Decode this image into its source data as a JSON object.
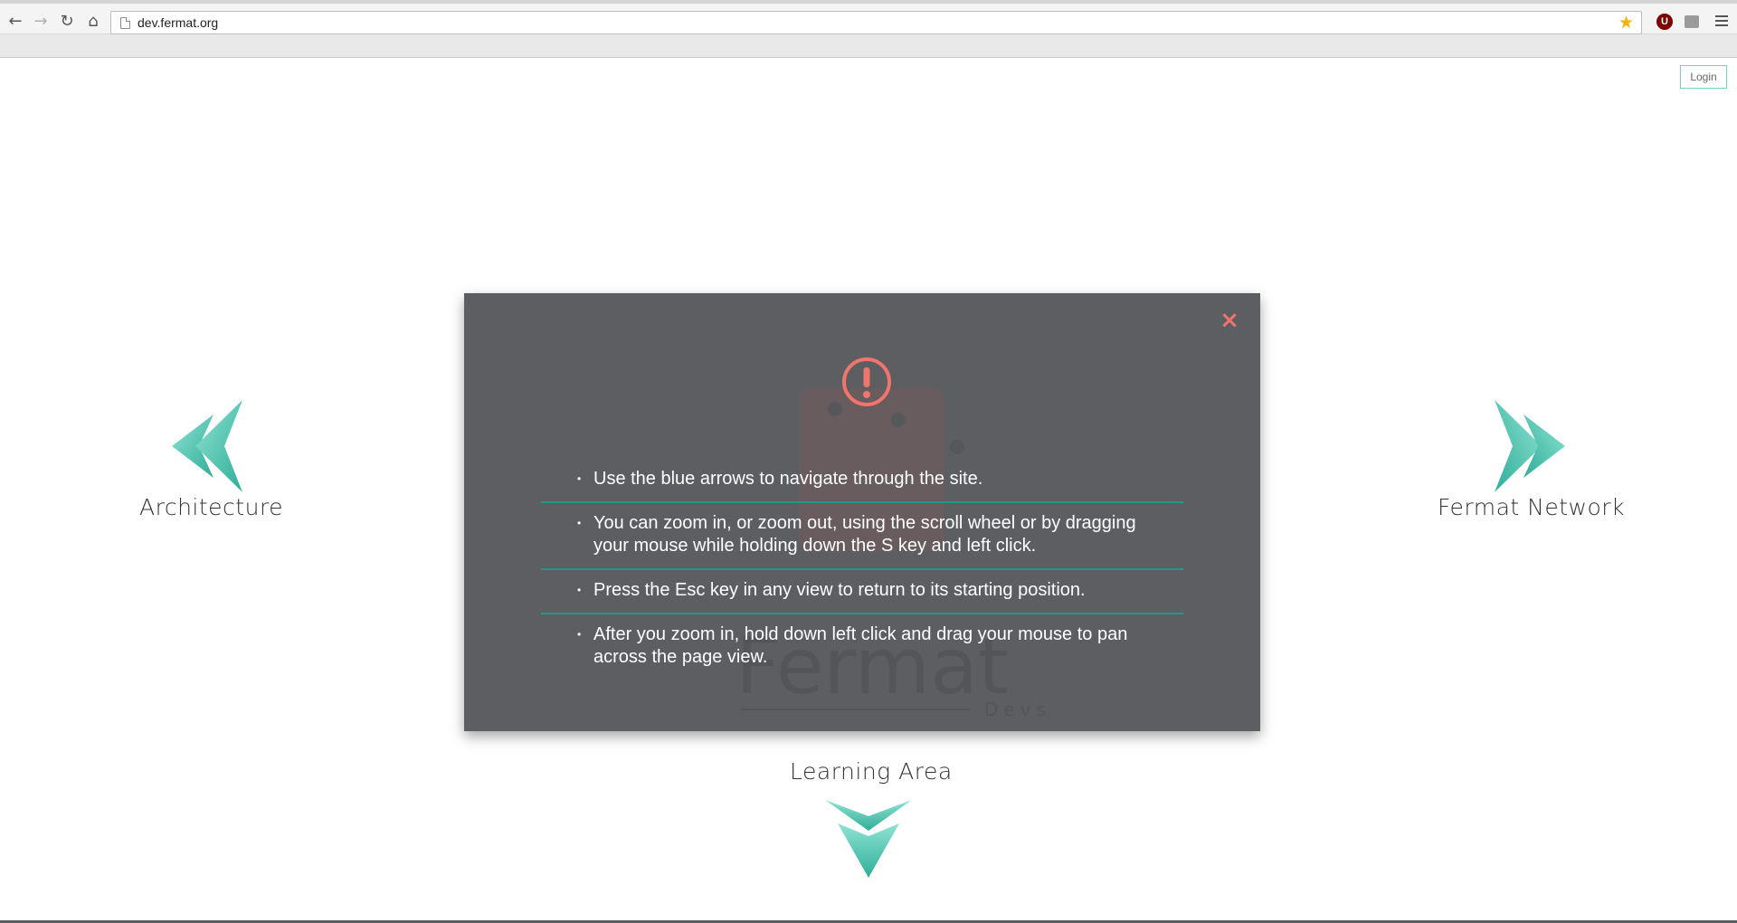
{
  "browser": {
    "url": "dev.fermat.org",
    "back_icon": "←",
    "forward_icon": "→",
    "reload_icon": "↻",
    "home_icon": "⌂",
    "star_icon": "★",
    "ext_ublock": "U"
  },
  "page": {
    "login_label": "Login",
    "nav_left_label": "Architecture",
    "nav_right_label": "Fermat Network",
    "nav_bottom_label": "Learning Area",
    "accent_color": "#5ccbb6"
  },
  "modal": {
    "close_icon": "×",
    "alert_color": "#f0756d",
    "tips": [
      "Use the blue arrows to navigate through the site.",
      "You can zoom in, or zoom out, using the scroll wheel or by dragging your mouse while holding down the S key and left click.",
      "Press the Esc key in any view to return to its starting position.",
      "After you zoom in, hold down left click and drag your mouse to pan across the page view."
    ]
  },
  "background_logo": {
    "word": "Fermat",
    "subword": "Devs"
  }
}
